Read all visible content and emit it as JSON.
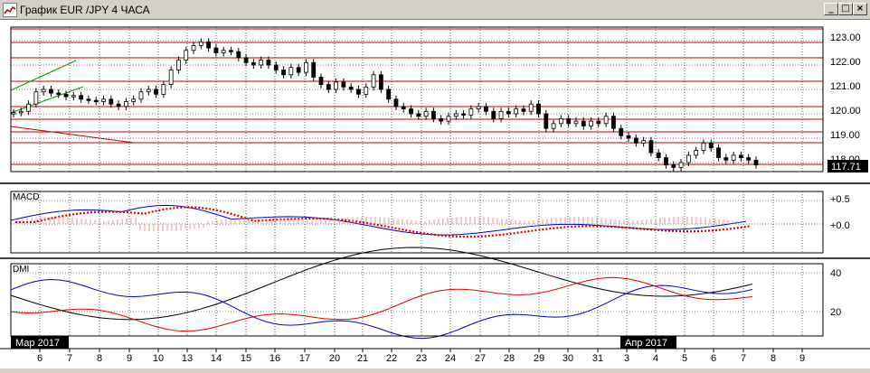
{
  "window": {
    "title": "График EUR /JPY  4 ЧАСА",
    "buttons": [
      "_",
      "□",
      "×"
    ]
  },
  "chart_data": [
    {
      "type": "candlestick",
      "symbol": "EUR/JPY",
      "timeframe": "4 ЧАСА",
      "y_ticks": [
        "123.00",
        "122.00",
        "121.00",
        "120.00",
        "119.00",
        "118.00"
      ],
      "ylim": [
        117.7,
        123.3
      ],
      "current_price": "117.71",
      "grid": true
    },
    {
      "type": "line",
      "title": "MACD",
      "y_ticks": [
        "+0.5",
        "+0.0"
      ]
    },
    {
      "type": "line",
      "title": "DMI",
      "y_ticks": [
        "40",
        "20"
      ]
    }
  ],
  "x_axis": {
    "ticks": [
      "6",
      "7",
      "8",
      "9",
      "10",
      "13",
      "14",
      "15",
      "16",
      "17",
      "20",
      "21",
      "22",
      "23",
      "24",
      "27",
      "28",
      "29",
      "30",
      "31",
      "3",
      "4",
      "5",
      "6",
      "7",
      "8",
      "9"
    ],
    "month_labels": [
      "Мар 2017",
      "Апр 2017"
    ]
  },
  "colors": {
    "price_line": "#c00000",
    "trend_green": "#00a000",
    "candle": "#000000",
    "dmi_plus": "#0000c0",
    "dmi_minus": "#e00000",
    "adx": "#000000",
    "macd_signal": "#e00000"
  }
}
